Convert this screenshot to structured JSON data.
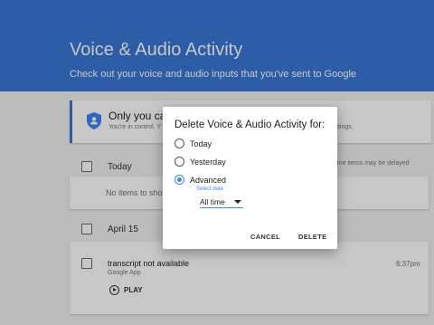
{
  "header": {
    "title": "Voice & Audio Activity",
    "subtitle": "Check out your voice and audio inputs that you've sent to Google"
  },
  "info_card": {
    "title": "Only you can s",
    "body": "You're in control. Y",
    "body_tail": "ttings.",
    "icon": "shield-person-icon"
  },
  "today_section": {
    "label": "Today",
    "delayed_note": "ome items may be delayed",
    "empty_text": "No items to sho"
  },
  "april_section": {
    "label": "April 15",
    "items": [
      {
        "name": "transcript not available",
        "app": "Google App",
        "time": "6:37pm",
        "play_label": "PLAY"
      }
    ]
  },
  "dialog": {
    "title": "Delete Voice & Audio Activity for:",
    "options": [
      "Today",
      "Yesterday",
      "Advanced"
    ],
    "selected_option": "Advanced",
    "select_date_label": "Select date",
    "dropdown_value": "All time",
    "cancel_label": "CANCEL",
    "delete_label": "DELETE"
  },
  "colors": {
    "header_bg": "#3c78d8",
    "accent": "#4285f4"
  }
}
